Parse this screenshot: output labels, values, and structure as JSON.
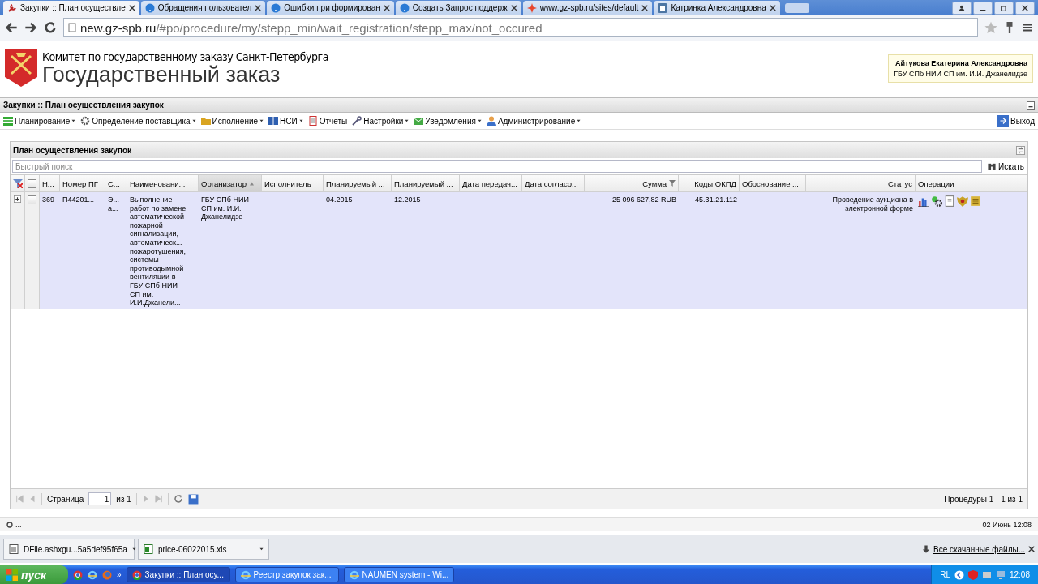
{
  "browser": {
    "tabs": [
      {
        "title": "Закупки :: План осуществле",
        "selected": true
      },
      {
        "title": "Обращения пользовател",
        "selected": false
      },
      {
        "title": "Ошибки при формирован",
        "selected": false
      },
      {
        "title": "Создать Запрос поддерж",
        "selected": false
      },
      {
        "title": "www.gz-spb.ru/sites/default",
        "selected": false
      },
      {
        "title": "Катринка Александровна",
        "selected": false
      }
    ],
    "url_host": "new.gz-spb.ru",
    "url_path": "/#po/procedure/my/stepp_min/wait_registration/stepp_max/not_occured"
  },
  "header": {
    "org": "Комитет по государственному заказу Санкт-Петербурга",
    "title": "Государственный заказ",
    "user_name": "Айтукова Екатерина Александровна",
    "user_org": "ГБУ СПб НИИ СП им. И.И. Джанелидзе"
  },
  "app_title": "Закупки :: План осуществления закупок",
  "menu": [
    {
      "label": "Планирование",
      "dropdown": true
    },
    {
      "label": "Определение поставщика",
      "dropdown": true
    },
    {
      "label": "Исполнение",
      "dropdown": true
    },
    {
      "label": "НСИ",
      "dropdown": true
    },
    {
      "label": "Отчеты",
      "dropdown": false
    },
    {
      "label": "Настройки",
      "dropdown": true
    },
    {
      "label": "Уведомления",
      "dropdown": true
    },
    {
      "label": "Администрирование",
      "dropdown": true
    }
  ],
  "logout": "Выход",
  "panel": {
    "title": "План осуществления закупок",
    "search": {
      "placeholder": "Быстрый поиск",
      "button": "Искать"
    },
    "all_checked": false,
    "columns": [
      {
        "label": "Н...",
        "sorted": false,
        "filtered": false
      },
      {
        "label": "Номер ПГ",
        "sorted": false,
        "filtered": false
      },
      {
        "label": "С...",
        "sorted": false,
        "filtered": false
      },
      {
        "label": "Наименовани...",
        "sorted": false,
        "filtered": false
      },
      {
        "label": "Организатор",
        "sorted": true,
        "filtered": false
      },
      {
        "label": "Исполнитель",
        "sorted": false,
        "filtered": false
      },
      {
        "label": "Планируемый ...",
        "sorted": false,
        "filtered": false
      },
      {
        "label": "Планируемый ...",
        "sorted": false,
        "filtered": false
      },
      {
        "label": "Дата передач...",
        "sorted": false,
        "filtered": false
      },
      {
        "label": "Дата согласо...",
        "sorted": false,
        "filtered": false
      },
      {
        "label": "Сумма",
        "sorted": false,
        "filtered": true
      },
      {
        "label": "Коды ОКПД",
        "sorted": false,
        "filtered": false
      },
      {
        "label": "Обоснование ...",
        "sorted": false,
        "filtered": false
      },
      {
        "label": "Статус",
        "sorted": false,
        "filtered": false
      },
      {
        "label": "Операции",
        "sorted": false,
        "filtered": false
      }
    ],
    "rows": [
      {
        "selected": true,
        "checked": false,
        "cells": [
          [
            "369"
          ],
          [
            "П44201..."
          ],
          [
            "Э...",
            "а..."
          ],
          [
            "Выполнение",
            "работ по замене",
            "автоматической",
            "пожарной",
            "сигнализации,",
            "автоматическ...",
            "пожаротушения,",
            "системы",
            "противодымной",
            "вентиляции в",
            "ГБУ СПб НИИ",
            "СП им.",
            "И.И.Джанели..."
          ],
          [
            "ГБУ СПб НИИ",
            "СП им. И.И.",
            "Джанелидзе"
          ],
          [],
          [
            "04.2015"
          ],
          [
            "12.2015"
          ],
          [
            "—"
          ],
          [
            "—"
          ],
          [
            "25 096 627,82 RUB"
          ],
          [
            "45.31.21.112"
          ],
          [],
          [
            "Проведение аукциона в",
            "электронной форме"
          ]
        ],
        "operations": [
          {
            "kind": "chart"
          },
          {
            "kind": "gear"
          },
          {
            "kind": "document"
          },
          {
            "kind": "emblem"
          },
          {
            "kind": "scroll"
          }
        ]
      }
    ],
    "pager": {
      "page_label": "Страница",
      "page": "1",
      "of": "из 1",
      "summary": "Процедуры 1 - 1 из 1"
    }
  },
  "status_bar": {
    "text": "...",
    "datetime": "02 Июнь 12:08"
  },
  "downloads": {
    "items": [
      {
        "name": "DFile.ashxgu...5a5def95f65a"
      },
      {
        "name": "price-06022015.xls"
      }
    ],
    "show_all": "Все скачанные файлы..."
  },
  "taskbar": {
    "start": "пуск",
    "more": "»",
    "buttons": [
      {
        "label": "Закупки :: План осу...",
        "selected": true
      },
      {
        "label": "Реестр закупок зак...",
        "selected": false
      },
      {
        "label": "NAUMEN system - Wi...",
        "selected": false
      }
    ],
    "lang": "RL",
    "clock": "12:08"
  }
}
